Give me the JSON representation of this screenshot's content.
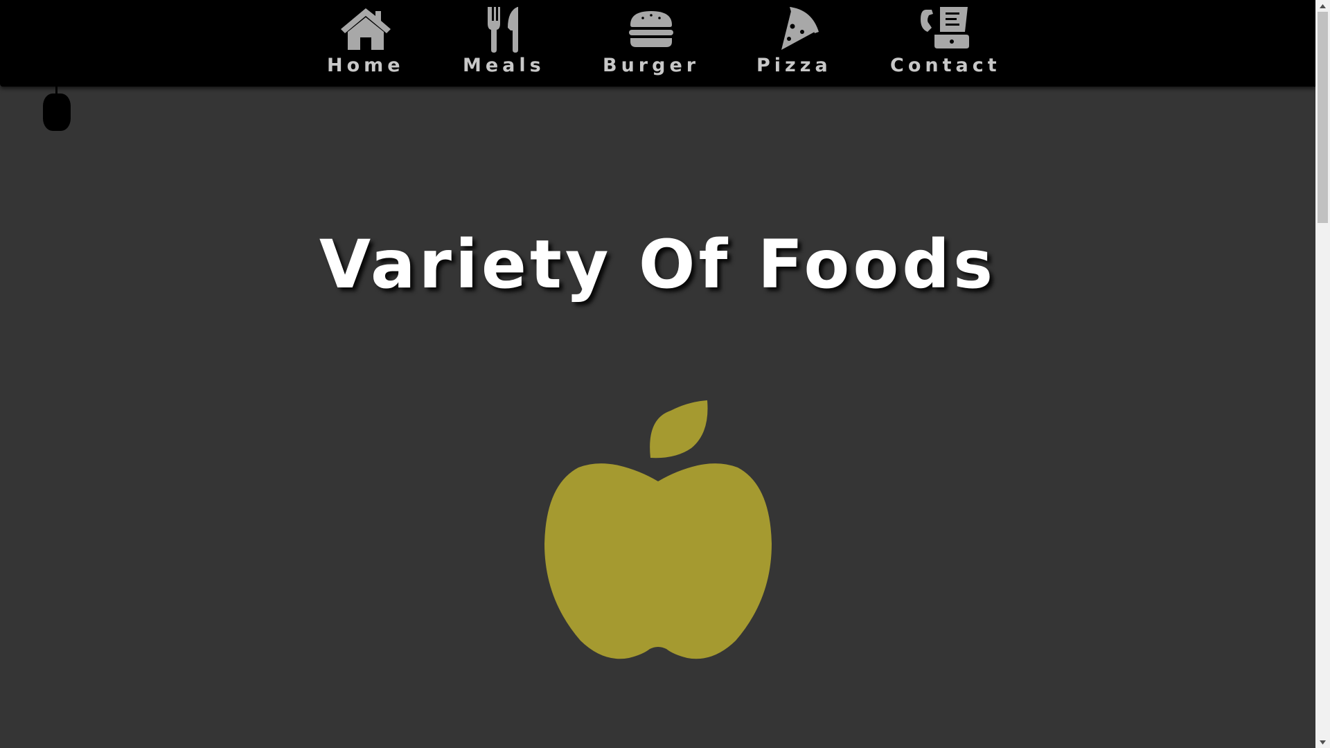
{
  "nav": {
    "items": [
      {
        "label": "Home",
        "icon": "house-icon"
      },
      {
        "label": "Meals",
        "icon": "utensils-icon"
      },
      {
        "label": "Burger",
        "icon": "burger-icon"
      },
      {
        "label": "Pizza",
        "icon": "pizza-slice-icon"
      },
      {
        "label": "Contact",
        "icon": "phone-fax-icon"
      }
    ]
  },
  "hero": {
    "title": "Variety Of Foods"
  },
  "colors": {
    "navbar_bg": "#000000",
    "page_bg": "#353535",
    "nav_text": "#c8c8c8",
    "nav_icon": "#a8a8a8",
    "title": "#ffffff",
    "apple": "#a59a30"
  }
}
